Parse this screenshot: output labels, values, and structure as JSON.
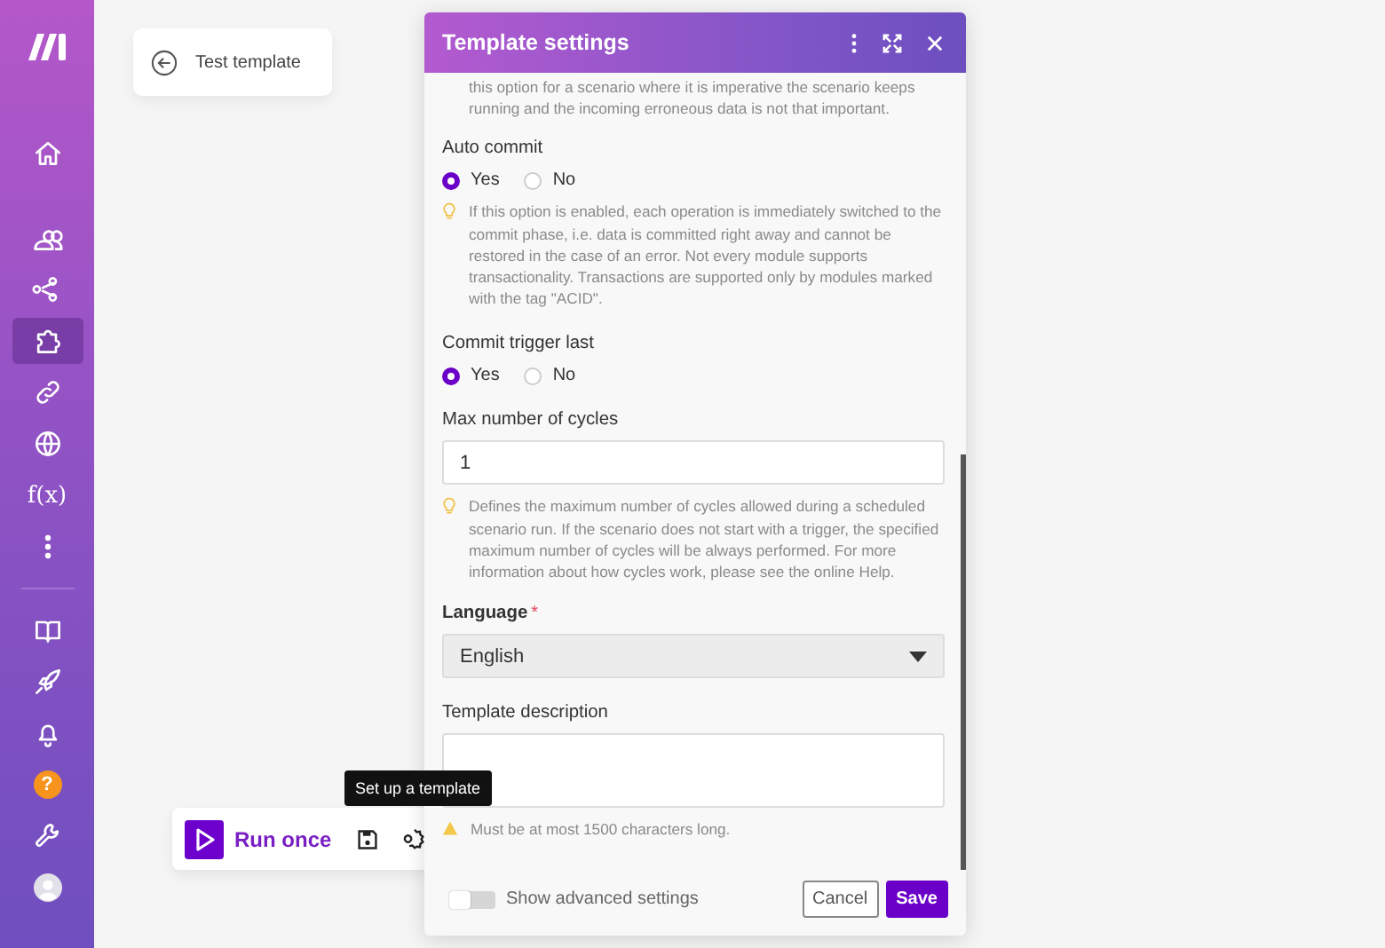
{
  "sidebar": {
    "groups": [
      [
        {
          "kind": "home",
          "selected": false
        }
      ],
      [
        {
          "kind": "users",
          "selected": false
        },
        {
          "kind": "share",
          "selected": false
        },
        {
          "kind": "puzzle",
          "selected": true
        },
        {
          "kind": "link",
          "selected": false
        },
        {
          "kind": "globe",
          "selected": false
        },
        {
          "kind": "function",
          "label": "f(x)",
          "selected": false
        },
        {
          "kind": "more",
          "selected": false
        }
      ],
      [
        {
          "kind": "book",
          "selected": false
        },
        {
          "kind": "rocket",
          "selected": false
        },
        {
          "kind": "bell",
          "selected": false
        },
        {
          "kind": "help",
          "label": "?",
          "selected": false
        },
        {
          "kind": "wrench",
          "selected": false
        },
        {
          "kind": "avatar",
          "selected": false
        }
      ]
    ]
  },
  "back_card": {
    "title": "Test template"
  },
  "toolbar": {
    "run_label": "Run once",
    "tooltip": "Set up a template"
  },
  "dialog": {
    "title": "Template settings",
    "sections": [
      {
        "kind": "note",
        "text": "this option for a scenario where it is imperative the scenario keeps running and the incoming erroneous data is not that important."
      },
      {
        "kind": "radio",
        "label": "Auto commit",
        "options": [
          {
            "label": "Yes",
            "selected": true
          },
          {
            "label": "No",
            "selected": false
          }
        ],
        "hint": {
          "kind": "tip",
          "text": "If this option is enabled, each operation is immediately switched to the commit phase, i.e. data is committed right away and cannot be restored in the case of an error. Not every module supports transactionality. Transactions are supported only by modules marked with the tag \"ACID\"."
        }
      },
      {
        "kind": "radio",
        "label": "Commit trigger last",
        "options": [
          {
            "label": "Yes",
            "selected": true
          },
          {
            "label": "No",
            "selected": false
          }
        ]
      },
      {
        "kind": "number",
        "label": "Max number of cycles",
        "value": "1",
        "hint": {
          "kind": "tip",
          "text": "Defines the maximum number of cycles allowed during a scheduled scenario run. If the scenario does not start with a trigger, the specified maximum number of cycles will be always performed. For more information about how cycles work, please see the online Help."
        }
      },
      {
        "kind": "select",
        "label": "Language",
        "required_mark": "*",
        "value": "English"
      },
      {
        "kind": "textarea",
        "label": "Template description",
        "hint": {
          "kind": "warning",
          "text": "Must be at most 1500 characters long."
        }
      }
    ],
    "advanced_toggle": {
      "label": "Show advanced settings",
      "on": false
    },
    "buttons": [
      {
        "kind": "secondary",
        "label": "Cancel"
      },
      {
        "kind": "primary",
        "label": "Save"
      }
    ]
  }
}
